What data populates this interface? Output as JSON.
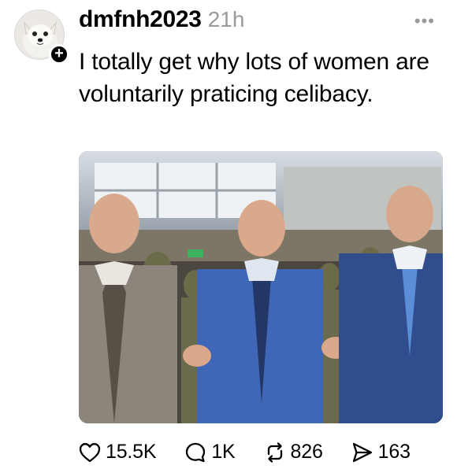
{
  "post": {
    "username": "dmfnh2023",
    "timestamp": "21h",
    "more_icon": "more-icon",
    "text": "I totally get why lots of women are voluntarily praticing celibacy.",
    "follow_badge": "+",
    "photo_alt": "Three men in suits standing in a room with soldiers in camouflage uniforms"
  },
  "actions": {
    "likes": "15.5K",
    "replies": "1K",
    "reposts": "826",
    "shares": "163"
  }
}
